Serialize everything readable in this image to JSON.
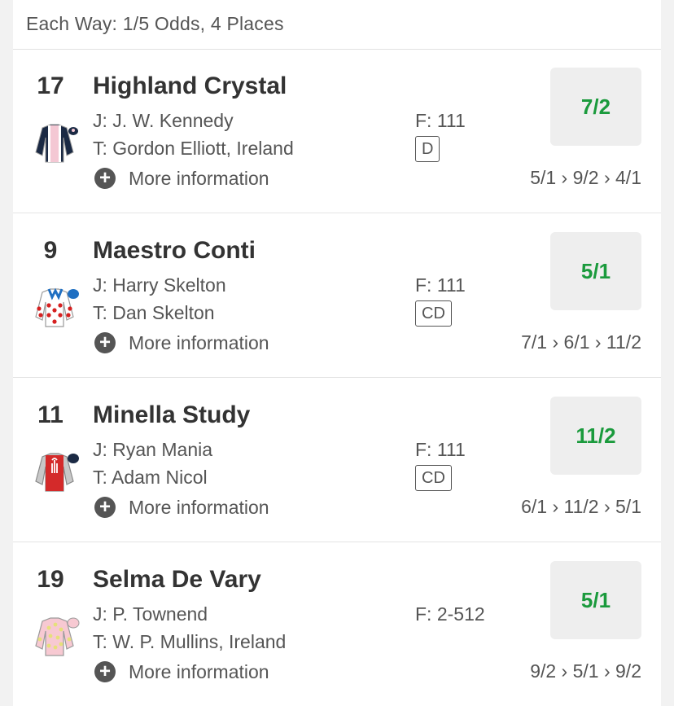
{
  "each_way": {
    "text": "Each Way: 1/5 Odds, 4 Places"
  },
  "runners": [
    {
      "number": "17",
      "name": "Highland Crystal",
      "jockey": "J: J. W. Kennedy",
      "trainer": "T: Gordon Elliott, Ireland",
      "more_info": "More information",
      "form": "F: 111",
      "badge": "D",
      "odds": "7/2",
      "odds_history": "5/1 › 9/2 › 4/1",
      "silk_icon": "jockey-silk-navy-white-pink"
    },
    {
      "number": "9",
      "name": "Maestro Conti",
      "jockey": "J: Harry Skelton",
      "trainer": "T: Dan Skelton",
      "more_info": "More information",
      "form": "F: 111",
      "badge": "CD",
      "odds": "5/1",
      "odds_history": "7/1 › 6/1 › 11/2",
      "silk_icon": "jockey-silk-white-red-spots-blue"
    },
    {
      "number": "11",
      "name": "Minella Study",
      "jockey": "J: Ryan Mania",
      "trainer": "T: Adam Nicol",
      "more_info": "More information",
      "form": "F: 111",
      "badge": "CD",
      "odds": "11/2",
      "odds_history": "6/1 › 11/2 › 5/1",
      "silk_icon": "jockey-silk-red-grey-navy"
    },
    {
      "number": "19",
      "name": "Selma De Vary",
      "jockey": "J: P. Townend",
      "trainer": "T: W. P. Mullins, Ireland",
      "more_info": "More information",
      "form": "F: 2-512",
      "badge": "",
      "odds": "5/1",
      "odds_history": "9/2 › 5/1 › 9/2",
      "silk_icon": "jockey-silk-pink-yellow-spots"
    }
  ],
  "colors": {
    "odds_text": "#1a9a3c",
    "odds_button_bg": "#eeeeee",
    "text_primary": "#333333",
    "text_secondary": "#555555"
  }
}
